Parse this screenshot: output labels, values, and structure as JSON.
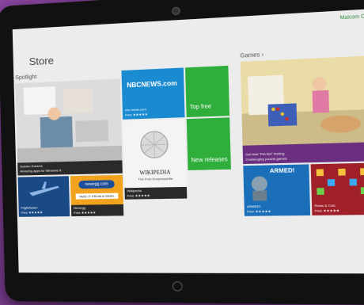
{
  "screen": {
    "user_badge": "Malcom CD",
    "title": "Store"
  },
  "sections": {
    "spotlight": "Spotlight",
    "games": "Games ›"
  },
  "tiles": {
    "sudoku": {
      "name": "Sudoku Dreams",
      "sub": "Amazing apps for Windows 8"
    },
    "nbc": {
      "logo": "NBCNEWS.com",
      "name": "nbc news.com",
      "rating": "Free ★★★★★"
    },
    "top_free": {
      "label": "Top free"
    },
    "new_releases": {
      "label": "New releases"
    },
    "wikipedia": {
      "logo_title": "WIKIPEDIA",
      "logo_sub": "The Free Encyclopedia",
      "name": "Wikipedia",
      "rating": "Free ★★★★★"
    },
    "flightaware": {
      "name": "FlightAware",
      "rating": "Free ★★★★★"
    },
    "newegg": {
      "logo": "newegg.com",
      "banner": "TAKE IT FROM A GEEK.",
      "name": "Newegg",
      "rating": "Free ★★★★★"
    },
    "four_in_row": {
      "name": "Get that \"Pet-fed\" feeling",
      "sub": "Challenging puzzle games"
    },
    "armed": {
      "logo": "ARMED!",
      "name": "ARMED!",
      "rating": "Free ★★★★★"
    },
    "rows": {
      "name": "Rows & Cols",
      "rating": "Free ★★★★★"
    }
  },
  "colors": {
    "blue": "#1b8bd1",
    "green": "#2fae3b",
    "purple": "#6b2f7f",
    "dark_blue": "#1a4a86",
    "red": "#a0202a"
  }
}
